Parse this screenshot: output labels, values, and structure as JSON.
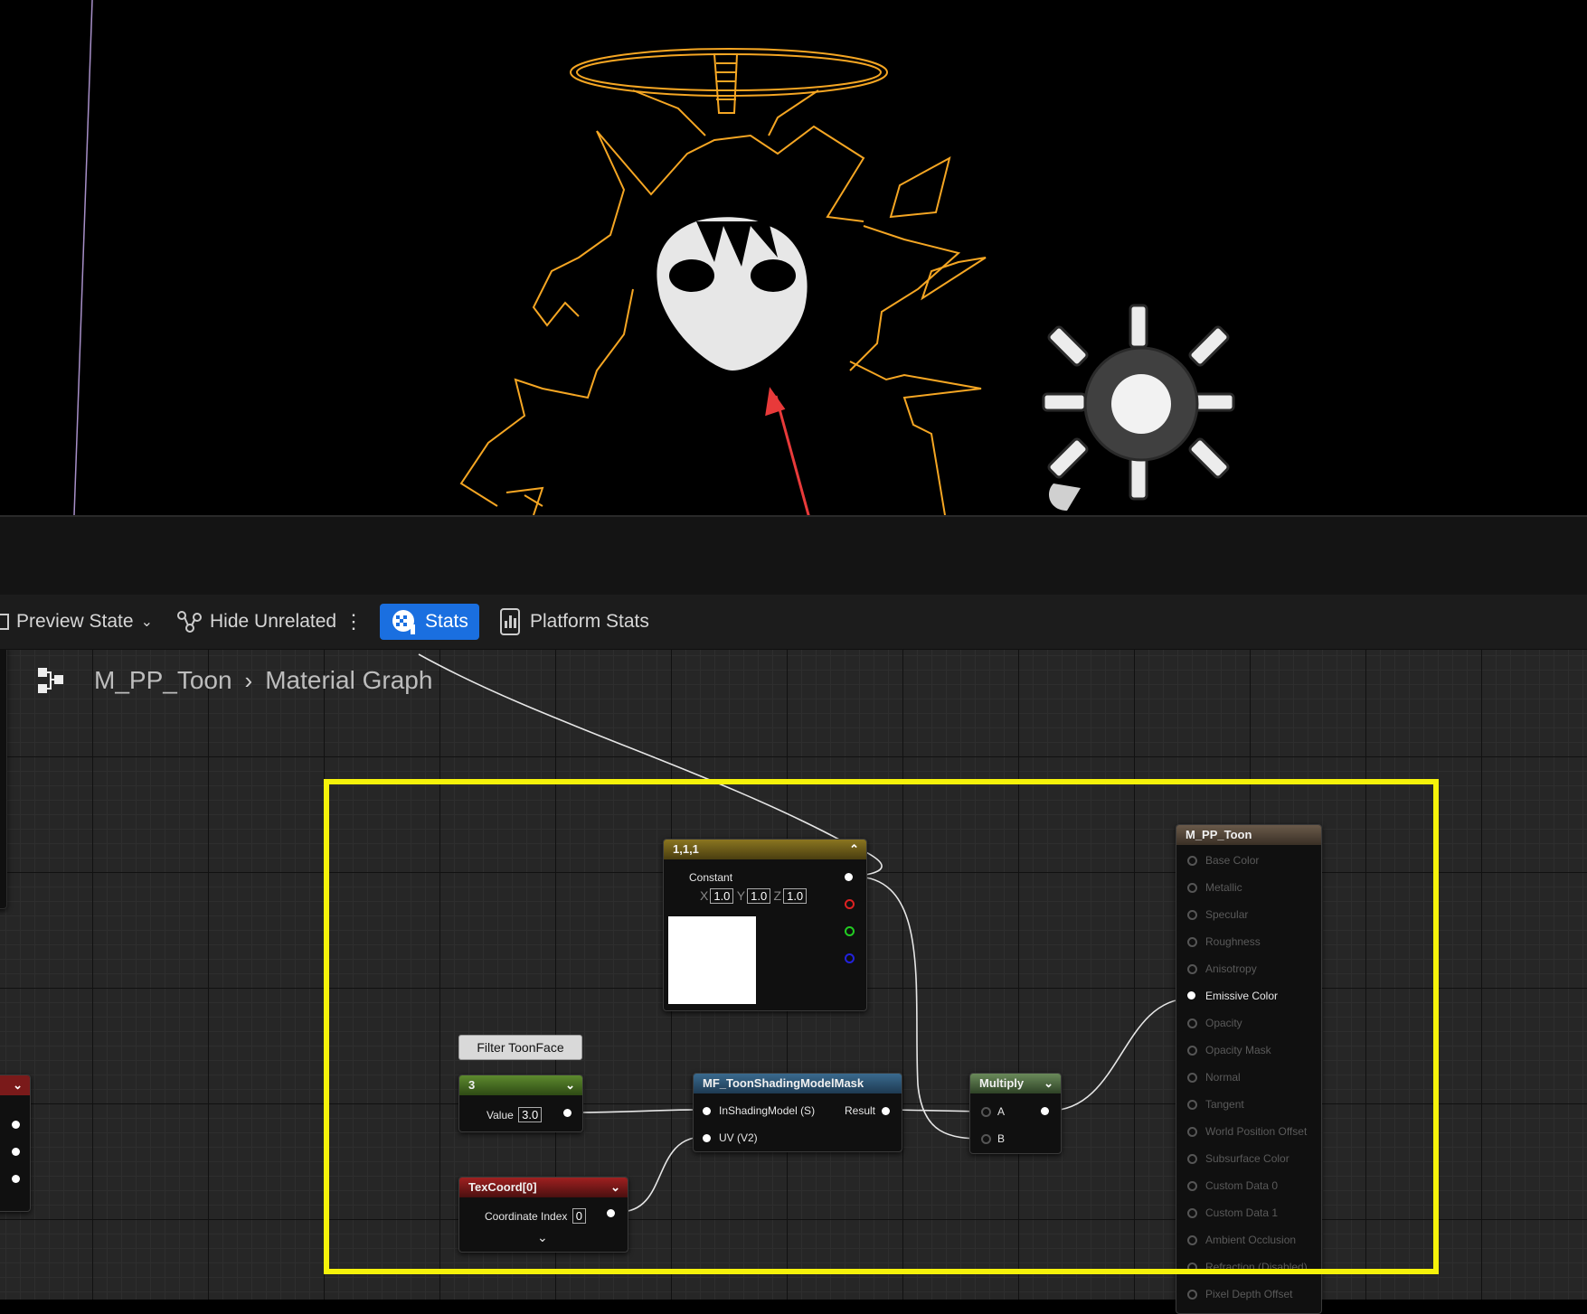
{
  "toolbar": {
    "preview_state": "Preview State",
    "hide_unrelated": "Hide Unrelated",
    "stats": "Stats",
    "platform_stats": "Platform Stats"
  },
  "breadcrumb": {
    "asset": "M_PP_Toon",
    "graph": "Material Graph"
  },
  "nodes": {
    "constant3": {
      "title": "1,1,1",
      "label": "Constant",
      "x": "1.0",
      "y": "1.0",
      "z": "1.0",
      "x_axis": "X",
      "y_axis": "Y",
      "z_axis": "Z"
    },
    "comment": {
      "text": "Filter ToonFace"
    },
    "scalar": {
      "title": "3",
      "value_label": "Value",
      "value": "3.0"
    },
    "texcoord": {
      "title": "TexCoord[0]",
      "index_label": "Coordinate Index",
      "index": "0"
    },
    "mask": {
      "title": "MF_ToonShadingModelMask",
      "in1": "InShadingModel (S)",
      "in2": "UV (V2)",
      "out": "Result"
    },
    "multiply": {
      "title": "Multiply",
      "a": "A",
      "b": "B"
    },
    "result": {
      "title": "M_PP_Toon",
      "pins": [
        {
          "label": "Base Color",
          "active": false
        },
        {
          "label": "Metallic",
          "active": false
        },
        {
          "label": "Specular",
          "active": false
        },
        {
          "label": "Roughness",
          "active": false
        },
        {
          "label": "Anisotropy",
          "active": false
        },
        {
          "label": "Emissive Color",
          "active": true
        },
        {
          "label": "Opacity",
          "active": false
        },
        {
          "label": "Opacity Mask",
          "active": false
        },
        {
          "label": "Normal",
          "active": false
        },
        {
          "label": "Tangent",
          "active": false
        },
        {
          "label": "World Position Offset",
          "active": false
        },
        {
          "label": "Subsurface Color",
          "active": false
        },
        {
          "label": "Custom Data 0",
          "active": false
        },
        {
          "label": "Custom Data 1",
          "active": false
        },
        {
          "label": "Ambient Occlusion",
          "active": false
        },
        {
          "label": "Refraction (Disabled)",
          "active": false
        },
        {
          "label": "Pixel Depth Offset",
          "active": false
        }
      ]
    }
  },
  "colors": {
    "outline": "#f5a623",
    "highlight": "#f5f20a",
    "annotation_arrow": "#e83a3a",
    "stats_button": "#1a6fe0"
  }
}
